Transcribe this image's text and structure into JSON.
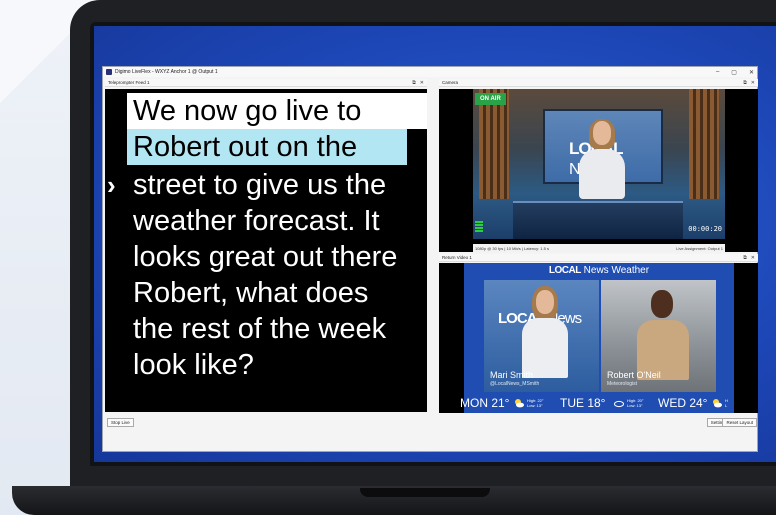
{
  "window": {
    "title": "Digimo LiveFlex - WXYZ Anchor 1 @ Output 1",
    "min": "–",
    "max": "▢",
    "close": "✕"
  },
  "panels": {
    "teleprompter": {
      "title": "Teleprompter Feed 1",
      "lines": [
        "We now go live to",
        "Robert out on the",
        "street to give us the",
        "weather forecast. It",
        "looks great out there",
        "Robert, what does",
        "the rest of the week",
        "look like?"
      ],
      "cursor": "›"
    },
    "camera": {
      "title": "Camera",
      "on_air": "ON AIR",
      "logo_local": "LOCAL",
      "logo_news": "News",
      "timecode": "00:00:20",
      "status_left": "1080p @ 30 fps | 10 Mb/s | Latency: 1.5 s",
      "status_right": "Live Assignment: Output 1"
    },
    "return_video": {
      "title": "Return Video 1",
      "header_local": "LOCAL",
      "header_rest": "News Weather",
      "logo_local": "LOCAL",
      "logo_news": "News",
      "left_name": "Mari Smith",
      "left_handle": "@LocalNews_MSmith",
      "right_name": "Robert O'Neil",
      "right_role": "Meteorologist",
      "ticker": [
        {
          "day": "MON 21°",
          "high": "High: 22°",
          "low": "Low: 13°"
        },
        {
          "day": "TUE 18°",
          "high": "High: 20°",
          "low": "Low: 13°"
        },
        {
          "day": "WED 24°",
          "high": "H",
          "low": "L"
        }
      ]
    }
  },
  "panel_controls": {
    "pop": "⧉",
    "close": "✕"
  },
  "buttons": {
    "stop_live": "Stop Live",
    "settings": "Settings",
    "reset_layout": "Reset Layout"
  },
  "colors": {
    "desktop_blue": "#1d47b7",
    "on_air_green": "#2aa348",
    "highlight_cyan": "#b3e6f3"
  }
}
